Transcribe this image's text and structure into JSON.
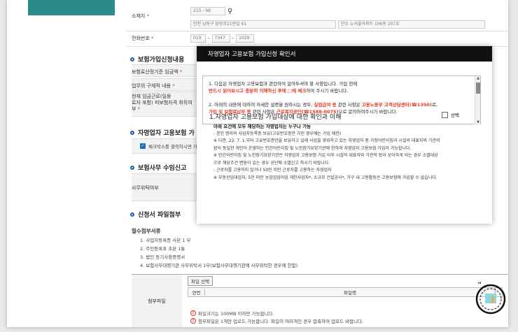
{
  "form": {
    "address_label": "소재지",
    "req_mark": "*",
    "zip_value": "215 - 96",
    "address_main": "인천 남동구 담방로21번길 61",
    "address_detail": "만수 뉴서울아파트 106동 207호",
    "phone_label": "전화번호",
    "phone_1": "010",
    "phone_2": "7347",
    "phone_3": "1029",
    "insurance_section": "보험가입신청내용",
    "wage_label": "보험료산정기준 임금액",
    "business_label": "업무의 구체적 내용",
    "status_label": "현재 임금근로(일용\n로자 포함) 피보험자격 취득여\n부",
    "self_employed_section": "자영업자 고용보험 가",
    "checkbox_text": "체크박스를 클릭하시면 가",
    "commission_section": "보험사무 수임신고",
    "commission_label": "사무위탁여부",
    "attachment_section": "신청서 파일첨부",
    "required_docs_title": "필수첨부서류",
    "docs": [
      "1. 사업자등록증 사본 1 부",
      "2. 주민등록표 초본 1통",
      "3. 법인 등기사항증명서",
      "4. 보험사무대행기관 사무위탁서 1부(보험사무대행기관에 사무위탁한 경우에 한함)"
    ],
    "attach_label": "첨부파일",
    "file_select_button": "파일 선택",
    "col_no": "연번",
    "col_filename": "파일명",
    "warn_1": "파일크기는 100MB 이하만 가능합니다.",
    "warn_2": "첨부파일은 1개만 업로드 가능합니다. 파일이 여러개인 경우 압축하여 업로드 바랍니다."
  },
  "modal": {
    "title": "자영업자 고용보험 가입신청 확인서",
    "notice_1a": "1. 다음은 자영업자 고용보험과 관련하여 알아두셔야 할 사항입니다. 가입 전에",
    "notice_1b_red": "반드시 읽어보시고 충분히 이해하신 후에 □에 체크",
    "notice_1c": "하여 주시기 바랍니다.",
    "notice_2a": "2. 아래의 내용에 대하여 자세한 설명을 원하시는 경우,",
    "notice_2b_red": "실업급여 등",
    "notice_2c": "관련 사항은",
    "notice_2d_red": "고용노동부 고객상담센터(☎1350)",
    "notice_2e": "로,",
    "notice_2f_red": "가입 및 보험료납부 등",
    "notice_2g": "관련 사항은",
    "notice_2h_red": "근로복지공단(☎1588-0075)",
    "notice_2i": "으로 문의하여주시기 바랍니다.",
    "section_title": "1.자영업자 고용보험 가입대상에 대한 확인과 이해",
    "confirm_label": "선택",
    "body_heading": "아래 요건에 모두 해당하는 자영업자는 누구나 가능",
    "body_1": "- 본인 명의의 사업자등록증 보유(고유번호증만 가진 경우에는 가입 제한)",
    "body_2": "※ 다만, 22. 7. 1.부터 고유번호증만을 보유하고 실제 사업을 영위하고 있는 자영업자 중 가정어린이집과 시설의 대표자와 기관의",
    "body_3": "장이 동일한 개인이 운영하는 민간어린이집 및 노인장기요양기관에 한하여 자영업자 고용보험 가입이 가능합니다.",
    "body_4": "※ 민간어린이집 및 노인장기요양기관은 자영업자 고용보험 가입 이후 시설의 대표자와 기관의 장이 상이하게 되는 경우 소멸대상",
    "body_5": "으로 해당조건 변동이 있는 경우 공단에 소멸신고 하시기 바랍니다.",
    "body_6": "- 근로자를 고용하지 않거나 50인 미만 근로자를 고용하는 자영업자",
    "body_7": "※ 부동산임대업자, 5인 미만 농업임업어업 개인사업자*, 소규모 건설공사*, 가구 내 고용활동은 고용보험에 가입할 수 없습니다."
  }
}
